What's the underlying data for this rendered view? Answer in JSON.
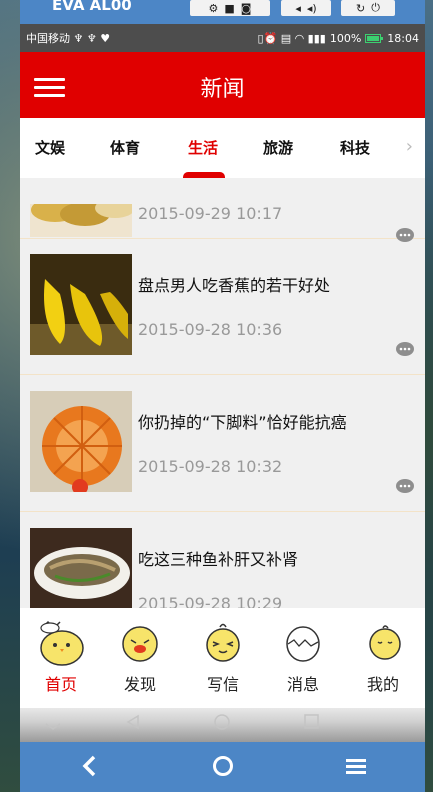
{
  "emulator": {
    "title": "EVA AL00",
    "back_icon": "chevron-left-icon",
    "home_icon": "circle-home-icon",
    "menu_icon": "hamburger-icon"
  },
  "status_bar": {
    "carrier": "中国移动 ♆ ♆ ♥",
    "battery": "100%",
    "time": "18:04"
  },
  "app_bar": {
    "title": "新闻",
    "menu_icon": "hamburger-icon"
  },
  "tabs": [
    {
      "label": "文娱",
      "active": false
    },
    {
      "label": "体育",
      "active": false
    },
    {
      "label": "生活",
      "active": true
    },
    {
      "label": "旅游",
      "active": false
    },
    {
      "label": "科技",
      "active": false
    }
  ],
  "news": [
    {
      "title": "",
      "date": "2015-09-29 10:17"
    },
    {
      "title": "盘点男人吃香蕉的若干好处",
      "date": "2015-09-28 10:36"
    },
    {
      "title": "你扔掉的“下脚料”恰好能抗癌",
      "date": "2015-09-28 10:32"
    },
    {
      "title": "吃这三种鱼补肝又补肾",
      "date": "2015-09-28 10:29"
    }
  ],
  "bottom_nav": [
    {
      "label": "首页",
      "active": true
    },
    {
      "label": "发现",
      "active": false
    },
    {
      "label": "写信",
      "active": false
    },
    {
      "label": "消息",
      "active": false
    },
    {
      "label": "我的",
      "active": false
    }
  ],
  "colors": {
    "primary": "#e00000",
    "emulator": "#4c86c6"
  }
}
